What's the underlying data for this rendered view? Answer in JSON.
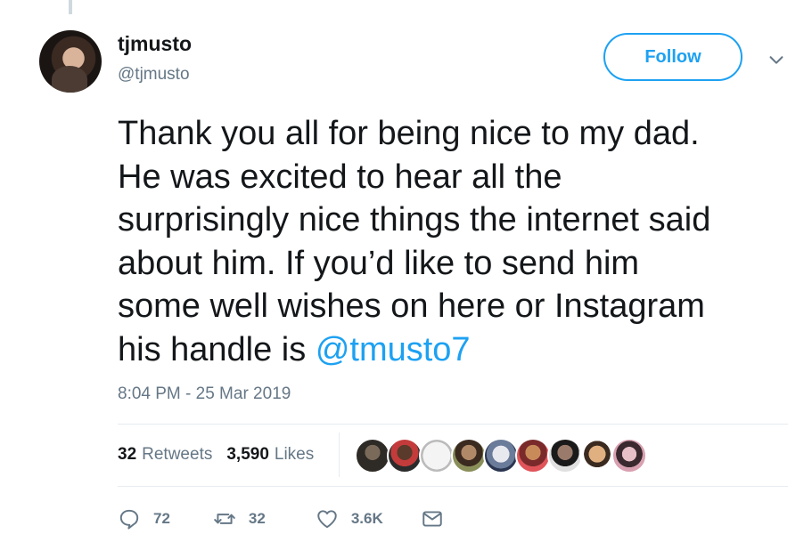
{
  "author": {
    "name": "tjmusto",
    "handle": "@tjmusto"
  },
  "follow_label": "Follow",
  "tweet": {
    "lines": [
      "Thank you all for being nice to my dad.",
      "He was excited to hear all the",
      "surprisingly nice things the internet said",
      "about him. If you’d like to send him",
      "some well wishes on here or Instagram"
    ],
    "last_line_prefix": "his handle is ",
    "mention": "@tmusto7"
  },
  "timestamp": "8:04 PM - 25 Mar 2019",
  "stats": {
    "retweets_count": "32",
    "retweets_label": "Retweets",
    "likes_count": "3,590",
    "likes_label": "Likes"
  },
  "actions": {
    "replies": "72",
    "retweets": "32",
    "likes": "3.6K"
  },
  "icons": {
    "reply": "reply-icon",
    "retweet": "retweet-icon",
    "like": "heart-icon",
    "message": "direct-message-icon",
    "caret": "chevron-down-icon"
  },
  "colors": {
    "accent": "#1da1f2",
    "secondary_text": "#657786",
    "primary_text": "#14171a"
  }
}
